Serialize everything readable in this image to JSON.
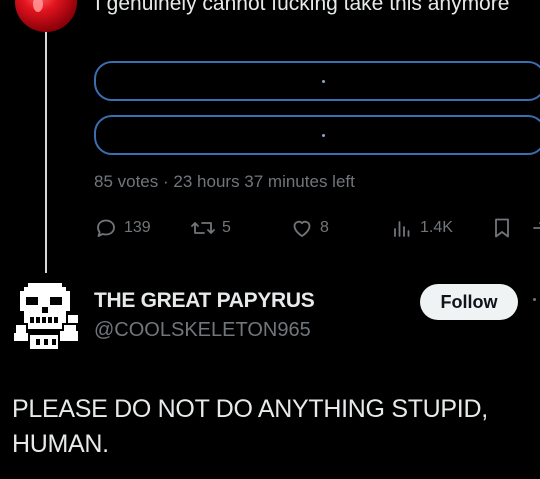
{
  "thread": {
    "tweet_text": "I genuinely cannot fucking take this anymore",
    "poll": {
      "options": [
        "",
        ""
      ],
      "votes": "85 votes",
      "separator": "·",
      "time_left": "23 hours 37 minutes left",
      "border_color": "#3b6fb0"
    },
    "actions": {
      "reply_icon": "reply-icon",
      "reply_count": "139",
      "retweet_icon": "retweet-icon",
      "retweet_count": "5",
      "like_icon": "heart-icon",
      "like_count": "8",
      "views_icon": "views-icon",
      "views_count": "1.4K",
      "bookmark_icon": "bookmark-icon",
      "share_icon": "share-icon"
    }
  },
  "post": {
    "author_name": "THE GREAT PAPYRUS",
    "author_handle": "@COOLSKELETON965",
    "follow_label": "Follow",
    "text": "PLEASE DO NOT DO ANYTHING STUPID, HUMAN."
  },
  "colors": {
    "background": "#000000",
    "text_primary": "#e7e9ea",
    "text_secondary": "#71767b",
    "follow_bg": "#eff3f4",
    "follow_text": "#0f1419",
    "avatar_red": "#d4121e"
  }
}
